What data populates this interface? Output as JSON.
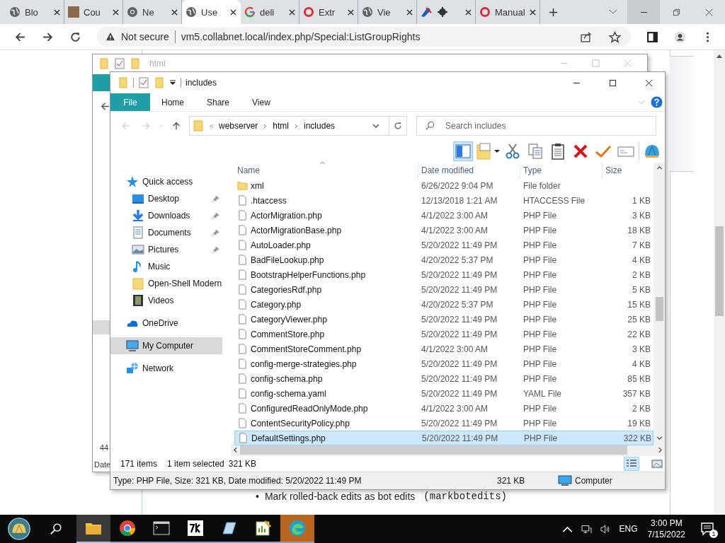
{
  "browser": {
    "tabs": [
      {
        "title": "Blo",
        "selected": false
      },
      {
        "title": "Cou",
        "selected": false
      },
      {
        "title": "Ne",
        "selected": false
      },
      {
        "title": "Use",
        "selected": true
      },
      {
        "title": "deli",
        "selected": false
      },
      {
        "title": "Extr",
        "selected": false
      },
      {
        "title": "Vie",
        "selected": false
      },
      {
        "selected": false
      },
      {
        "title": "Manual",
        "selected": false
      }
    ],
    "security": "Not secure",
    "url": "vm5.collabnet.local/index.php/Special:ListGroupRights"
  },
  "page": {
    "back_window_texts": [
      "44",
      "Date"
    ],
    "list": [
      {
        "bullet": "•",
        "text": "Mark rolled-back edits as bot edits",
        "code": "(markbotedits)"
      }
    ]
  },
  "back_window": {
    "title": "html"
  },
  "explorer": {
    "title": "includes",
    "ribbon": [
      {
        "label": "File",
        "kind": "menu"
      },
      {
        "label": "Home",
        "kind": "tab"
      },
      {
        "label": "Share",
        "kind": "tab"
      },
      {
        "label": "View",
        "kind": "tab"
      }
    ],
    "breadcrumb": [
      "webserver",
      "html",
      "includes"
    ],
    "search": {
      "placeholder": "Search includes"
    },
    "nav": [
      {
        "label": "Quick access",
        "children": [
          {
            "label": "Desktop",
            "pinned": true
          },
          {
            "label": "Downloads",
            "pinned": true
          },
          {
            "label": "Documents",
            "pinned": true
          },
          {
            "label": "Pictures",
            "pinned": true
          },
          {
            "label": "Music",
            "pinned": false
          },
          {
            "label": "Open-Shell Modern",
            "pinned": false
          },
          {
            "label": "Videos",
            "pinned": false
          }
        ],
        "selected": false
      },
      {
        "label": "OneDrive",
        "selected": false
      },
      {
        "label": "My Computer",
        "selected": true
      },
      {
        "label": "Network",
        "selected": false
      }
    ],
    "columns": [
      "Name",
      "Date modified",
      "Type",
      "Size"
    ],
    "files": [
      {
        "kind": "folder",
        "name": "xml",
        "date": "6/26/2022 9:04 PM",
        "type": "File folder",
        "selected": false
      },
      {
        "kind": "file",
        "name": ".htaccess",
        "date": "12/13/2018 1:21 AM",
        "type": "HTACCESS File",
        "size": "1 KB",
        "selected": false
      },
      {
        "kind": "file",
        "name": "ActorMigration.php",
        "date": "4/1/2022 3:00 AM",
        "type": "PHP File",
        "size": "3 KB",
        "selected": false
      },
      {
        "kind": "file",
        "name": "ActorMigrationBase.php",
        "date": "4/1/2022 3:00 AM",
        "type": "PHP File",
        "size": "18 KB",
        "selected": false
      },
      {
        "kind": "file",
        "name": "AutoLoader.php",
        "date": "5/20/2022 11:49 PM",
        "type": "PHP File",
        "size": "7 KB",
        "selected": false
      },
      {
        "kind": "file",
        "name": "BadFileLookup.php",
        "date": "4/20/2022 5:37 PM",
        "type": "PHP File",
        "size": "4 KB",
        "selected": false
      },
      {
        "kind": "file",
        "name": "BootstrapHelperFunctions.php",
        "date": "5/20/2022 11:49 PM",
        "type": "PHP File",
        "size": "2 KB",
        "selected": false
      },
      {
        "kind": "file",
        "name": "CategoriesRdf.php",
        "date": "5/20/2022 11:49 PM",
        "type": "PHP File",
        "size": "5 KB",
        "selected": false
      },
      {
        "kind": "file",
        "name": "Category.php",
        "date": "4/20/2022 5:37 PM",
        "type": "PHP File",
        "size": "15 KB",
        "selected": false
      },
      {
        "kind": "file",
        "name": "CategoryViewer.php",
        "date": "5/20/2022 11:49 PM",
        "type": "PHP File",
        "size": "25 KB",
        "selected": false
      },
      {
        "kind": "file",
        "name": "CommentStore.php",
        "date": "5/20/2022 11:49 PM",
        "type": "PHP File",
        "size": "22 KB",
        "selected": false
      },
      {
        "kind": "file",
        "name": "CommentStoreComment.php",
        "date": "4/1/2022 3:00 AM",
        "type": "PHP File",
        "size": "3 KB",
        "selected": false
      },
      {
        "kind": "file",
        "name": "config-merge-strategies.php",
        "date": "5/20/2022 11:49 PM",
        "type": "PHP File",
        "size": "4 KB",
        "selected": false
      },
      {
        "kind": "file",
        "name": "config-schema.php",
        "date": "5/20/2022 11:49 PM",
        "type": "PHP File",
        "size": "85 KB",
        "selected": false
      },
      {
        "kind": "file",
        "name": "config-schema.yaml",
        "date": "5/20/2022 11:49 PM",
        "type": "YAML File",
        "size": "357 KB",
        "selected": false
      },
      {
        "kind": "file",
        "name": "ConfiguredReadOnlyMode.php",
        "date": "4/1/2022 3:00 AM",
        "type": "PHP File",
        "size": "2 KB",
        "selected": false
      },
      {
        "kind": "file",
        "name": "ContentSecurityPolicy.php",
        "date": "5/20/2022 11:49 PM",
        "type": "PHP File",
        "size": "19 KB",
        "selected": false
      },
      {
        "kind": "file",
        "name": "DefaultSettings.php",
        "date": "5/20/2022 11:49 PM",
        "type": "PHP File",
        "size": "322 KB",
        "selected": true
      }
    ],
    "status": {
      "items": "171 items",
      "selection": "1 item selected",
      "size": "321 KB"
    },
    "details": {
      "text": "Type: PHP File, Size: 321 KB, Date modified: 5/20/2022 11:49 PM",
      "size": "321 KB",
      "location": "Computer"
    }
  },
  "taskbar": {
    "apps": [
      {
        "active": true,
        "flashing": false
      },
      {
        "active": false,
        "flashing": false
      },
      {
        "active": false,
        "flashing": false
      },
      {
        "active": false,
        "flashing": false
      },
      {
        "active": false,
        "flashing": false
      },
      {
        "active": false,
        "flashing": false
      },
      {
        "active": false,
        "flashing": true
      }
    ],
    "language": "ENG",
    "time": "3:00 PM",
    "date": "7/15/2022",
    "notifications": "1"
  }
}
